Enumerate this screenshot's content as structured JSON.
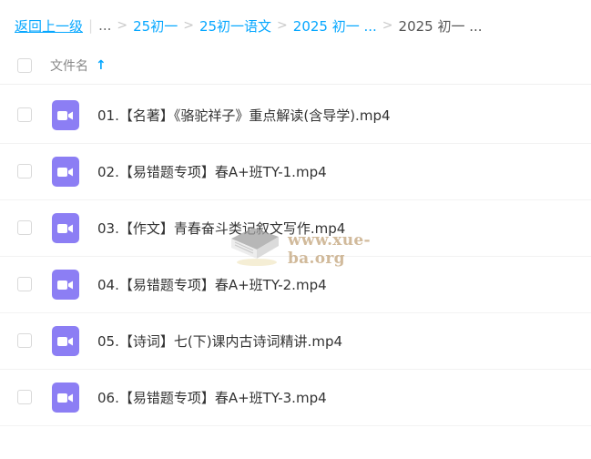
{
  "breadcrumb": {
    "back_label": "返回上一级",
    "ellipsis": "...",
    "items": [
      "25初一",
      "25初一语文",
      "2025 初一 ..."
    ],
    "current": "2025 初一 ..."
  },
  "header": {
    "file_name_label": "文件名",
    "sort_icon": "↑"
  },
  "files": [
    {
      "name": "01.【名著】《骆驼祥子》重点解读(含导学).mp4",
      "icon": "video-icon"
    },
    {
      "name": "02.【易错题专项】春A+班TY-1.mp4",
      "icon": "video-icon"
    },
    {
      "name": "03.【作文】青春奋斗类记叙文写作.mp4",
      "icon": "video-icon"
    },
    {
      "name": "04.【易错题专项】春A+班TY-2.mp4",
      "icon": "video-icon"
    },
    {
      "name": "05.【诗词】七(下)课内古诗词精讲.mp4",
      "icon": "video-icon"
    },
    {
      "name": "06.【易错题专项】春A+班TY-3.mp4",
      "icon": "video-icon"
    }
  ],
  "watermark": {
    "text": "www.xue-ba.org"
  },
  "colors": {
    "accent": "#06a7ff",
    "video_icon": "#8c7ef4"
  }
}
